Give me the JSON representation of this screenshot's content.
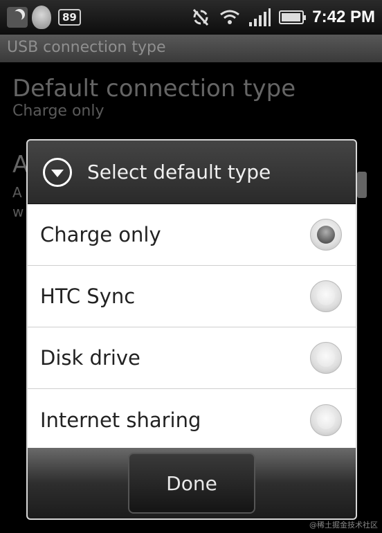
{
  "status_bar": {
    "notification_count": "89",
    "time": "7:42 PM",
    "icons": [
      "moon-icon",
      "avatar-icon",
      "sync-off-icon",
      "wifi-icon",
      "signal-icon",
      "battery-icon"
    ]
  },
  "title_bar": {
    "title": "USB connection type"
  },
  "background": {
    "pref1_title": "Default connection type",
    "pref1_sub": "Charge only",
    "pref2_initial": "A",
    "pref2_line2": "A",
    "pref2_line3": "w"
  },
  "dialog": {
    "title": "Select default type",
    "options": [
      {
        "label": "Charge only",
        "checked": true
      },
      {
        "label": "HTC Sync",
        "checked": false
      },
      {
        "label": "Disk drive",
        "checked": false
      },
      {
        "label": "Internet sharing",
        "checked": false
      }
    ],
    "done_label": "Done"
  },
  "watermark": "@稀土掘金技术社区"
}
